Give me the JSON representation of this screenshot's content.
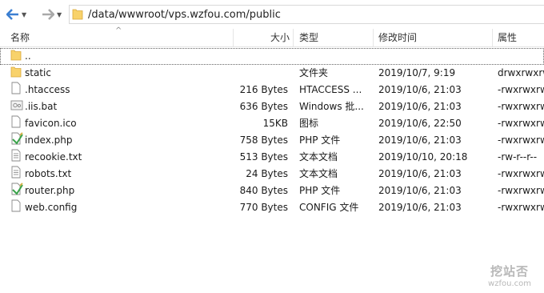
{
  "address": {
    "path": "/data/wwwroot/vps.wzfou.com/public"
  },
  "columns": {
    "name": "名称",
    "size": "大小",
    "type": "类型",
    "modified": "修改时间",
    "attrs": "属性"
  },
  "files": [
    {
      "name": "..",
      "size": "",
      "type": "",
      "modified": "",
      "attrs": "",
      "icon": "folder-icon"
    },
    {
      "name": "static",
      "size": "",
      "type": "文件夹",
      "modified": "2019/10/7, 9:19",
      "attrs": "drwxrwxrw",
      "icon": "folder-icon"
    },
    {
      "name": ".htaccess",
      "size": "216 Bytes",
      "type": "HTACCESS ...",
      "modified": "2019/10/6, 21:03",
      "attrs": "-rwxrwxrw",
      "icon": "file-icon"
    },
    {
      "name": ".iis.bat",
      "size": "636 Bytes",
      "type": "Windows 批...",
      "modified": "2019/10/6, 21:03",
      "attrs": "-rwxrwxrw",
      "icon": "batch-file-icon"
    },
    {
      "name": "favicon.ico",
      "size": "15KB",
      "type": "图标",
      "modified": "2019/10/6, 22:50",
      "attrs": "-rwxrwxrw",
      "icon": "file-icon"
    },
    {
      "name": "index.php",
      "size": "758 Bytes",
      "type": "PHP 文件",
      "modified": "2019/10/6, 21:03",
      "attrs": "-rwxrwxrw",
      "icon": "php-file-icon"
    },
    {
      "name": "recookie.txt",
      "size": "513 Bytes",
      "type": "文本文档",
      "modified": "2019/10/10, 20:18",
      "attrs": "-rw-r--r--",
      "icon": "text-file-icon"
    },
    {
      "name": "robots.txt",
      "size": "24 Bytes",
      "type": "文本文档",
      "modified": "2019/10/6, 21:03",
      "attrs": "-rwxrwxrw",
      "icon": "text-file-icon"
    },
    {
      "name": "router.php",
      "size": "840 Bytes",
      "type": "PHP 文件",
      "modified": "2019/10/6, 21:03",
      "attrs": "-rwxrwxrw",
      "icon": "php-file-icon"
    },
    {
      "name": "web.config",
      "size": "770 Bytes",
      "type": "CONFIG 文件",
      "modified": "2019/10/6, 21:03",
      "attrs": "-rwxrwxrw",
      "icon": "file-icon"
    }
  ],
  "watermark": {
    "brand": "挖站否",
    "url": "wzfou.com"
  },
  "colors": {
    "folder": "#f8d26b",
    "back_arrow": "#3c7fd1",
    "forward_arrow": "#a9a9a9"
  }
}
